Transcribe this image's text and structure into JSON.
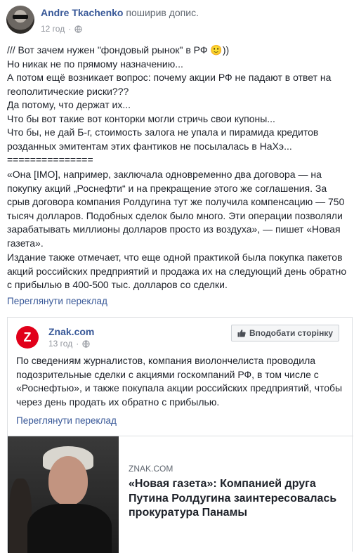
{
  "post": {
    "author": "Andre Tkachenko",
    "action": "поширив допис.",
    "time": "12 год",
    "text_lines": [
      "/// Вот зачем нужен \"фондовый рынок\" в РФ 🙂))",
      "Но никак не по прямому назначению...",
      "А потом ещё возникает вопрос: почему акции РФ не падают в ответ на",
      "геополитические риски???",
      "Да потому, что держат их...",
      "Что бы вот такие вот конторки могли стричь свои купоны...",
      "Что бы, не дай Б-г, стоимость залога не упала и пирамида кредитов",
      "розданных эмитентам этих фантиков не посылалась в НаХэ...",
      "==============="
    ],
    "quote": "«Она [IMO], например, заключала одновременно два договора — на покупку акций „Роснефти“ и на прекращение этого же соглашения. За срыв договора компания Ролдугина тут же получила компенсацию — 750 тысяч долларов. Подобных сделок было много. Эти операции позволяли зарабатывать миллионы долларов просто из воздуха», — пишет «Новая газета».",
    "paragraph2": "Издание также отмечает, что еще одной практикой была покупка пакетов акций российских предприятий и продажа их на следующий день обратно с прибылью в 400-500 тыс. долларов со сделки.",
    "translate": "Переглянути переклад"
  },
  "shared": {
    "page_name": "Znak.com",
    "logo_letter": "Z",
    "time": "13 год",
    "like_button": "Вподобати сторінку",
    "text": "По сведениям журналистов, компания виолончелиста проводила подозрительные сделки с акциями госкомпаний РФ, в том числе с «Роснефтью», и также покупала акции российских предприятий, чтобы через день продать их обратно с прибылью.",
    "translate": "Переглянути переклад",
    "link": {
      "site": "ZNAK.COM",
      "title": "«Новая газета»: Компанией друга Путина Ролдугина заинтересовалась прокуратура Панамы"
    }
  },
  "colors": {
    "link": "#385898",
    "brand_znak": "#e1001a",
    "meta": "#90949c"
  },
  "icons": [
    "globe-icon",
    "like-icon"
  ]
}
